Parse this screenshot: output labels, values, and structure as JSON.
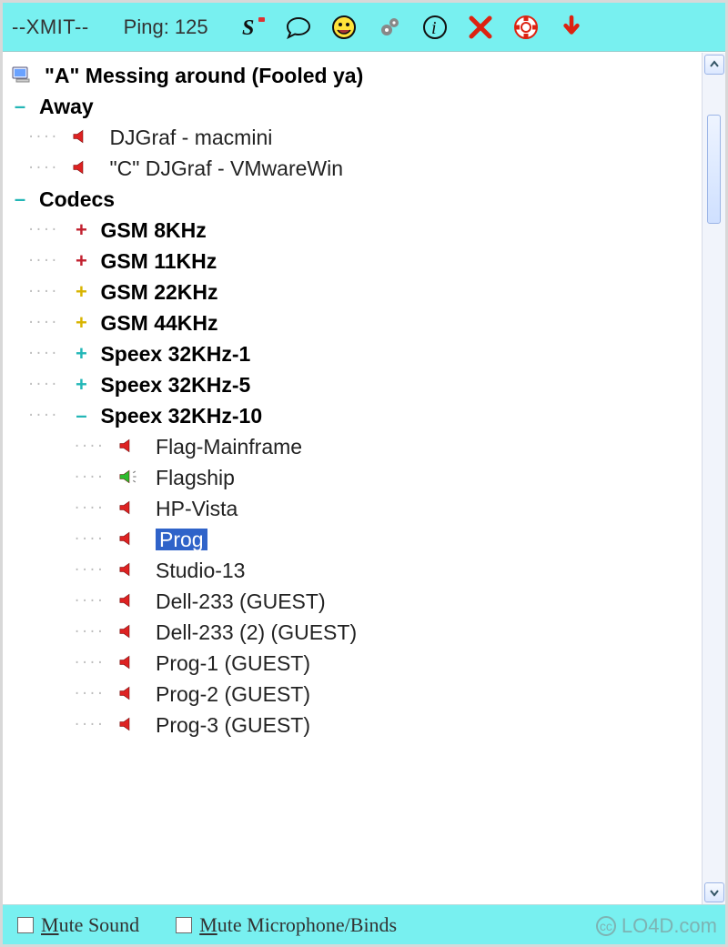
{
  "toolbar": {
    "xmit_label": "--XMIT--",
    "ping_label": "Ping: 125"
  },
  "tree": {
    "root_label": "\"A\" Messing around (Fooled ya)",
    "away": {
      "label": "Away",
      "items": [
        {
          "name": "DJGraf - macmini",
          "speaker": "red"
        },
        {
          "name": "\"C\" DJGraf - VMwareWin",
          "speaker": "red"
        }
      ]
    },
    "codecs": {
      "label": "Codecs",
      "groups": [
        {
          "plus": "red",
          "label": "GSM 8KHz"
        },
        {
          "plus": "red",
          "label": "GSM 11KHz"
        },
        {
          "plus": "yellow",
          "label": "GSM 22KHz"
        },
        {
          "plus": "yellow",
          "label": "GSM 44KHz"
        },
        {
          "plus": "teal",
          "label": "Speex 32KHz-1"
        },
        {
          "plus": "teal",
          "label": "Speex 32KHz-5"
        }
      ],
      "open_group": {
        "label": "Speex 32KHz-10",
        "items": [
          {
            "name": "Flag-Mainframe",
            "speaker": "red"
          },
          {
            "name": "Flagship",
            "speaker": "green"
          },
          {
            "name": "HP-Vista",
            "speaker": "red"
          },
          {
            "name": "Prog",
            "speaker": "red",
            "selected": true
          },
          {
            "name": "Studio-13",
            "speaker": "red"
          },
          {
            "name": "Dell-233 (GUEST)",
            "speaker": "red"
          },
          {
            "name": "Dell-233 (2) (GUEST)",
            "speaker": "red"
          },
          {
            "name": "Prog-1 (GUEST)",
            "speaker": "red"
          },
          {
            "name": "Prog-2 (GUEST)",
            "speaker": "red"
          },
          {
            "name": "Prog-3 (GUEST)",
            "speaker": "red"
          }
        ]
      }
    }
  },
  "footer": {
    "mute_sound_label": "ute Sound",
    "mute_sound_hotkey": "M",
    "mute_mic_label": "ute Microphone/Binds",
    "mute_mic_hotkey": "M"
  },
  "watermark": "LO4D.com"
}
